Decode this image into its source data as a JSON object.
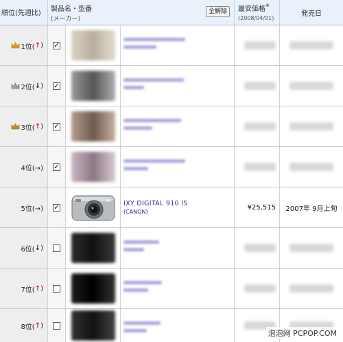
{
  "header": {
    "rank_label": "順位(先週比)",
    "product_label": "製品名・型番",
    "maker_label": "(メーカー)",
    "clear_button": "全解除",
    "price_label": "最安価格",
    "price_note": "※",
    "price_date": "(2008/04/01)",
    "release_label": "発売日"
  },
  "rows": [
    {
      "rank": "1位(",
      "arrow": "↑",
      "close": ")",
      "crown": "gold",
      "checked": true
    },
    {
      "rank": "2位(",
      "arrow": "↓",
      "close": ")",
      "crown": "silver",
      "checked": true
    },
    {
      "rank": "3位(",
      "arrow": "↑",
      "close": ")",
      "crown": "bronze",
      "checked": true
    },
    {
      "rank": "4位(→)",
      "arrow": "",
      "close": "",
      "crown": "",
      "checked": true
    },
    {
      "rank": "5位(→)",
      "arrow": "",
      "close": "",
      "crown": "",
      "checked": true,
      "product_name": "IXY DIGITAL 910 IS",
      "maker": "(CANON)",
      "price": "¥25,515",
      "release": "2007年 9月上旬"
    },
    {
      "rank": "6位(",
      "arrow": "↓",
      "close": ")",
      "crown": "",
      "checked": false
    },
    {
      "rank": "7位(",
      "arrow": "↑",
      "close": ")",
      "crown": "",
      "checked": false
    },
    {
      "rank": "8位(",
      "arrow": "↑",
      "close": ")",
      "crown": "",
      "checked": false
    }
  ],
  "checkmark": "✓",
  "watermark": "泡泡网 PCPOP.COM",
  "colors": {
    "link": "#2a1fa6",
    "arrow_up": "#d22222",
    "header_bg": "#e9f1fb",
    "gold": "#e0a020",
    "silver": "#a0a0a0",
    "bronze": "#c8902a"
  }
}
